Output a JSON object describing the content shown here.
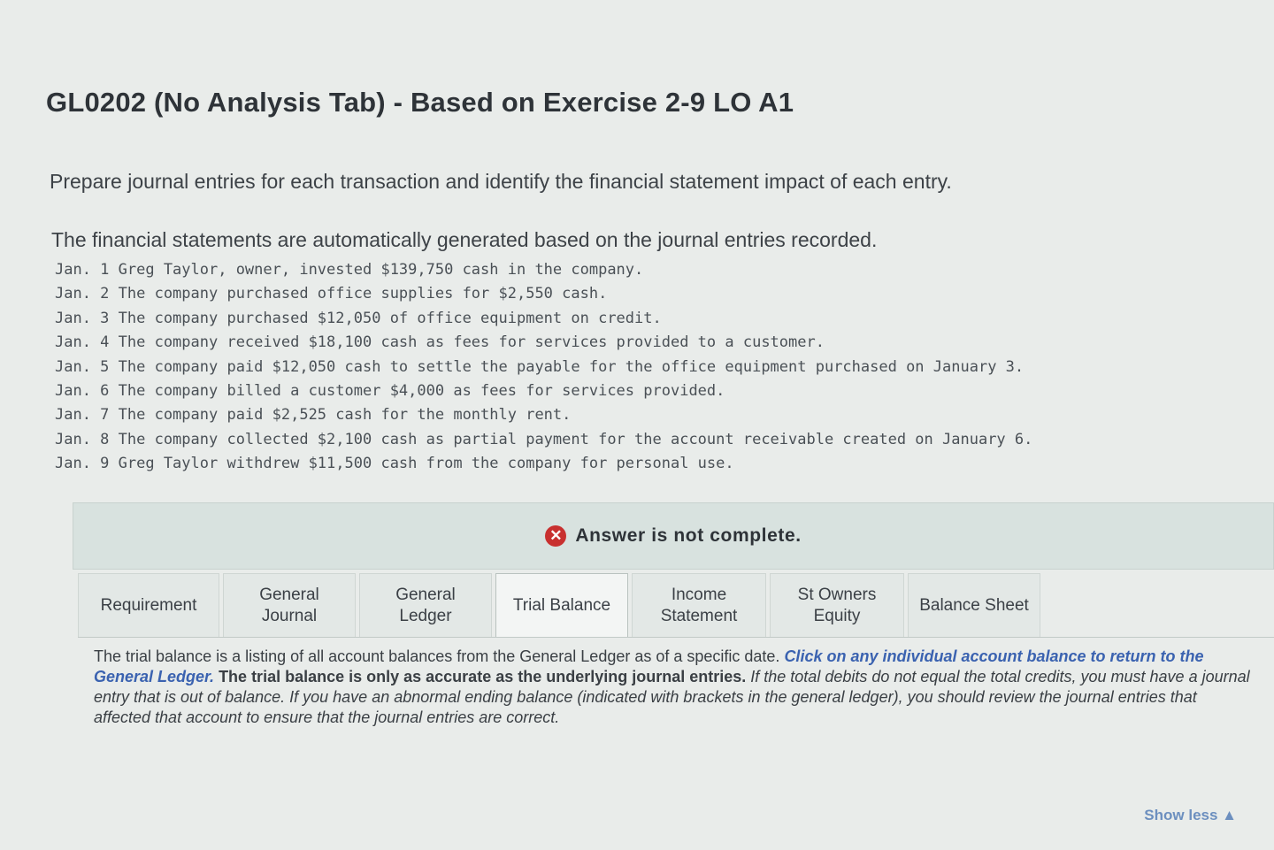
{
  "page": {
    "title": "GL0202 (No Analysis Tab) - Based on Exercise 2-9 LO A1",
    "instruction": "Prepare journal entries for each transaction and identify the financial statement impact of each entry.",
    "auto_note": "The financial statements are automatically generated based on the journal entries recorded."
  },
  "transactions": [
    "Jan. 1 Greg Taylor, owner, invested $139,750 cash in the company.",
    "Jan. 2 The company purchased office supplies for $2,550 cash.",
    "Jan. 3 The company purchased $12,050 of office equipment on credit.",
    "Jan. 4 The company received $18,100 cash as fees for services provided to a customer.",
    "Jan. 5 The company paid $12,050 cash to settle the payable for the office equipment purchased on January 3.",
    "Jan. 6 The company billed a customer $4,000 as fees for services provided.",
    "Jan. 7 The company paid $2,525 cash for the monthly rent.",
    "Jan. 8 The company collected $2,100 cash as partial payment for the account receivable created on January 6.",
    "Jan. 9 Greg Taylor withdrew $11,500 cash from the company for personal use."
  ],
  "answer_banner": {
    "icon": "error-x-icon",
    "text": "Answer is not complete.",
    "icon_color": "#c8302f"
  },
  "tabs": {
    "requirement": "Requirement",
    "general_journal_1": "General",
    "general_journal_2": "Journal",
    "general_ledger_1": "General",
    "general_ledger_2": "Ledger",
    "trial_balance": "Trial Balance",
    "income_statement_1": "Income",
    "income_statement_2": "Statement",
    "owners_equity_1": "St Owners",
    "owners_equity_2": "Equity",
    "balance_sheet": "Balance Sheet",
    "active": "Trial Balance"
  },
  "trial_balance_panel": {
    "intro": "The trial balance is a listing of all account balances from the General Ledger as of a specific date. ",
    "link": "Click on any individual account balance to return to the General Ledger.",
    "accuracy": " The trial balance is only as accurate as the underlying journal entries.",
    "warning": " If the total debits do not equal the total credits, you must have a journal entry that is out of balance. If you have an abnormal ending balance (indicated with brackets in the general ledger), you should review the journal entries that affected that account to ensure that the journal entries are correct."
  },
  "show_less": "Show less ▲",
  "colors": {
    "link": "#3a62b0",
    "banner_bg": "#d8e2df",
    "page_bg": "#e9ecea"
  }
}
